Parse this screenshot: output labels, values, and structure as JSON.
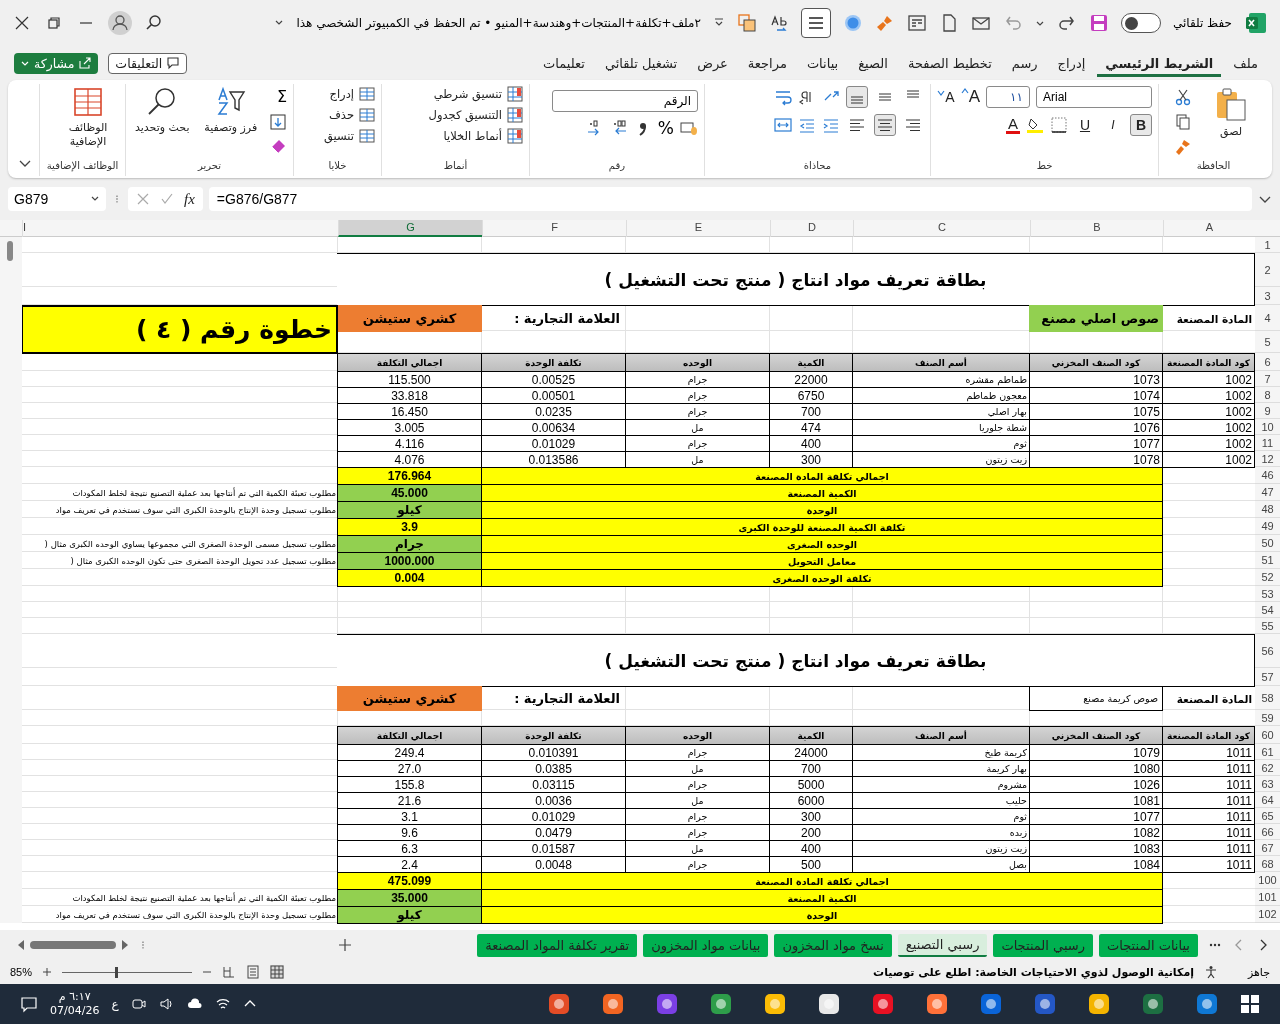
{
  "title_bar": {
    "autosave_label": "حفظ تلقائي",
    "autosave_on": false,
    "file_name": "٢ملف+تكلفة+المنتجات+وهندسة+المنيو • تم الحفظ في الكمبيوتر الشخصي هذا"
  },
  "ribbon_tabs": [
    {
      "label": "ملف",
      "selected": false
    },
    {
      "label": "الشريط الرئيسي",
      "selected": true
    },
    {
      "label": "إدراج",
      "selected": false
    },
    {
      "label": "رسم",
      "selected": false
    },
    {
      "label": "تخطيط الصفحة",
      "selected": false
    },
    {
      "label": "الصيغ",
      "selected": false
    },
    {
      "label": "بيانات",
      "selected": false
    },
    {
      "label": "مراجعة",
      "selected": false
    },
    {
      "label": "عرض",
      "selected": false
    },
    {
      "label": "تشغيل تلقائي",
      "selected": false
    },
    {
      "label": "تعليمات",
      "selected": false
    }
  ],
  "comments_label": "التعليقات",
  "share_label": "مشاركة",
  "ribbon": {
    "clipboard": {
      "label": "الحافظة",
      "paste": "لصق"
    },
    "font": {
      "label": "خط",
      "name": "Arial",
      "size": "١١",
      "grow": "A",
      "shrink": "A",
      "color_letter": "A",
      "styles": [
        {
          "kind": "bold",
          "label": "B",
          "on": true
        },
        {
          "kind": "italic",
          "label": "I",
          "on": false
        },
        {
          "kind": "underline",
          "label": "U",
          "on": false
        }
      ]
    },
    "alignment": {
      "label": "محاذاة",
      "vertical": [
        {
          "kind": "top",
          "selected": false
        },
        {
          "kind": "middle",
          "selected": false
        },
        {
          "kind": "bottom",
          "selected": true
        }
      ],
      "horizontal": [
        {
          "kind": "right",
          "selected": false
        },
        {
          "kind": "center",
          "selected": true
        },
        {
          "kind": "left",
          "selected": false
        }
      ]
    },
    "number": {
      "label": "رقم",
      "format": "الرقم",
      "percent": "%"
    },
    "styles": {
      "label": "أنماط",
      "items": [
        "تنسيق شرطي",
        "التنسيق كجدول",
        "أنماط الخلايا"
      ]
    },
    "cells": {
      "label": "خلايا",
      "items": [
        "إدراج",
        "حذف",
        "تنسيق"
      ]
    },
    "editing": {
      "label": "تحرير",
      "sum": "Σ",
      "sort": "فرز وتصفية",
      "find": "بحث وتحديد"
    },
    "addins": {
      "label": "الوظائف الإضافية",
      "button": "الوظائف الإضافية"
    }
  },
  "formula_bar": {
    "name_box": "G879",
    "fx": "fx",
    "formula": "=G876/G877"
  },
  "column_headers": [
    {
      "label": "A",
      "selected": false
    },
    {
      "label": "B",
      "selected": false
    },
    {
      "label": "C",
      "selected": false
    },
    {
      "label": "D",
      "selected": false
    },
    {
      "label": "E",
      "selected": false
    },
    {
      "label": "F",
      "selected": false
    },
    {
      "label": "G",
      "selected": true
    },
    {
      "label": "I",
      "selected": false
    }
  ],
  "sheet": {
    "rows": [
      {
        "nums": [
          "1"
        ],
        "kind": "blank"
      },
      {
        "nums": [
          "2",
          "3"
        ],
        "kind": "title",
        "text": "بطاقة تعريف مواد انتاج ( منتج تحت التشغيل )"
      },
      {
        "nums": [
          "4",
          "5"
        ],
        "kind": "material",
        "label": "المادة المصنعة",
        "value": "صوص اصلي مصنع",
        "highlighted": true,
        "brand_label": "العلامة التجارية :",
        "brand": "كشري ستيشن",
        "step": "خطوة رقم ( ٤ )"
      },
      {
        "nums": [
          "6"
        ],
        "kind": "header",
        "cells": [
          "كود المادة المصنعة",
          "كود الصنف المخزني",
          "أسم الصنف",
          "الكمية",
          "الوحده",
          "تكلفة الوحدة",
          "اجمالي التكلفة"
        ]
      },
      {
        "nums": [
          "7"
        ],
        "kind": "item",
        "cells": [
          "1002",
          "1073",
          "طماطم مقشره",
          "22000",
          "جرام",
          "0.00525",
          "115.500"
        ]
      },
      {
        "nums": [
          "8"
        ],
        "kind": "item",
        "cells": [
          "1002",
          "1074",
          "معجون طماطم",
          "6750",
          "جرام",
          "0.00501",
          "33.818"
        ]
      },
      {
        "nums": [
          "9"
        ],
        "kind": "item",
        "cells": [
          "1002",
          "1075",
          "بهار اصلي",
          "700",
          "جرام",
          "0.0235",
          "16.450"
        ]
      },
      {
        "nums": [
          "10"
        ],
        "kind": "item",
        "cells": [
          "1002",
          "1076",
          "شطة جلوريا",
          "474",
          "مل",
          "0.00634",
          "3.005"
        ]
      },
      {
        "nums": [
          "11"
        ],
        "kind": "item",
        "cells": [
          "1002",
          "1077",
          "ثوم",
          "400",
          "جرام",
          "0.01029",
          "4.116"
        ]
      },
      {
        "nums": [
          "12"
        ],
        "kind": "item",
        "cells": [
          "1002",
          "1078",
          "زيت زيتون",
          "300",
          "مل",
          "0.013586",
          "4.076"
        ]
      },
      {
        "nums": [
          "46"
        ],
        "kind": "summary",
        "label": "اجمالي تكلفة المادة المصنعة",
        "value": "176.964",
        "input": false
      },
      {
        "nums": [
          "47"
        ],
        "kind": "summary",
        "label": "الكمية المصنعة",
        "value": "45.000",
        "input": true,
        "note": "مطلوب تعبئة الكمية التي تم أنتاجها بعد عملية التصنيع نتيجة لخلط المكودات"
      },
      {
        "nums": [
          "48"
        ],
        "kind": "summary",
        "label": "الوحدة",
        "value": "كيلو",
        "input": true,
        "note": "مطلوب تسجيل وحدة الإنتاج بالوحدة الكبرى التي سوف تستخدم في تعريف مواد"
      },
      {
        "nums": [
          "49"
        ],
        "kind": "summary",
        "label": "تكلفة الكمية المصنعة للوحدة الكبرى",
        "value": "3.9",
        "input": false
      },
      {
        "nums": [
          "50"
        ],
        "kind": "summary",
        "label": "الوحده الصغرى",
        "value": "جرام",
        "input": true,
        "note": "مطلوب تسجيل مسمى الوحدة الصغرى التي مجموعها يساوي الوحده الكبرى مثال ("
      },
      {
        "nums": [
          "51"
        ],
        "kind": "summary",
        "label": "معامل التحويل",
        "value": "1000.000",
        "input": true,
        "note": "مطلوب تسجيل عدد تحويل الوحدة الصغرى حتى تكون الوحده الكبرى مثال ("
      },
      {
        "nums": [
          "52"
        ],
        "kind": "summary",
        "label": "تكلفة الوحده الصغرى",
        "value": "0.004",
        "input": false
      },
      {
        "nums": [
          "53",
          "54",
          "55"
        ],
        "kind": "blank"
      },
      {
        "nums": [
          "56",
          "57"
        ],
        "kind": "title",
        "text": "بطاقة تعريف مواد انتاج ( منتج تحت التشغيل )"
      },
      {
        "nums": [
          "58"
        ],
        "kind": "material",
        "label": "المادة المصنعة",
        "value": "صوص كريمة مصنع",
        "highlighted": false,
        "brand_label": "العلامة التجارية :",
        "brand": "كشري ستيشن"
      },
      {
        "nums": [
          "59"
        ],
        "kind": "blank"
      },
      {
        "nums": [
          "60"
        ],
        "kind": "header",
        "cells": [
          "كود المادة المصنعة",
          "كود الصنف المخزني",
          "أسم الصنف",
          "الكمية",
          "الوحده",
          "تكلفة الوحدة",
          "اجمالي التكلفة"
        ]
      },
      {
        "nums": [
          "61"
        ],
        "kind": "item",
        "cells": [
          "1011",
          "1079",
          "كريمة طبخ",
          "24000",
          "جرام",
          "0.010391",
          "249.4"
        ]
      },
      {
        "nums": [
          "62"
        ],
        "kind": "item",
        "cells": [
          "1011",
          "1080",
          "بهار كريمة",
          "700",
          "مل",
          "0.0385",
          "27.0"
        ]
      },
      {
        "nums": [
          "63"
        ],
        "kind": "item",
        "cells": [
          "1011",
          "1026",
          "مشروم",
          "5000",
          "جرام",
          "0.03115",
          "155.8"
        ]
      },
      {
        "nums": [
          "64"
        ],
        "kind": "item",
        "cells": [
          "1011",
          "1081",
          "حليب",
          "6000",
          "مل",
          "0.0036",
          "21.6"
        ]
      },
      {
        "nums": [
          "65"
        ],
        "kind": "item",
        "cells": [
          "1011",
          "1077",
          "ثوم",
          "300",
          "جرام",
          "0.01029",
          "3.1"
        ]
      },
      {
        "nums": [
          "66"
        ],
        "kind": "item",
        "cells": [
          "1011",
          "1082",
          "زبده",
          "200",
          "جرام",
          "0.0479",
          "9.6"
        ]
      },
      {
        "nums": [
          "67"
        ],
        "kind": "item",
        "cells": [
          "1011",
          "1083",
          "زيت زيتون",
          "400",
          "مل",
          "0.01587",
          "6.3"
        ]
      },
      {
        "nums": [
          "68"
        ],
        "kind": "item",
        "cells": [
          "1011",
          "1084",
          "بصل",
          "500",
          "جرام",
          "0.0048",
          "2.4"
        ]
      },
      {
        "nums": [
          "100"
        ],
        "kind": "summary",
        "label": "اجمالي تكلفة المادة المصنعة",
        "value": "475.099",
        "input": false
      },
      {
        "nums": [
          "101"
        ],
        "kind": "summary",
        "label": "الكمية المصنعة",
        "value": "35.000",
        "input": true,
        "note": "مطلوب تعبئة الكمية التي تم أنتاجها بعد عملية التصنيع نتيجة لخلط المكودات"
      },
      {
        "nums": [
          "102"
        ],
        "kind": "summary",
        "label": "الوحدة",
        "value": "كيلو",
        "input": true,
        "note": "مطلوب تسجيل وحدة الإنتاج بالوحدة الكبرى التي سوف تستخدم في تعريف مواد"
      }
    ]
  },
  "sheet_tabs": [
    {
      "label": "بيانات المنتجات",
      "selected": false
    },
    {
      "label": "رسبي المنتجات",
      "selected": false
    },
    {
      "label": "رسبي التصنيع",
      "selected": true
    },
    {
      "label": "نسخ مواد المخزون",
      "selected": false
    },
    {
      "label": "بيانات مواد المخزون",
      "selected": false
    },
    {
      "label": "تقرير تكلفة المواد المصنعة",
      "selected": false
    }
  ],
  "status_bar": {
    "ready": "جاهز",
    "accessibility": "إمكانية الوصول لذوي الاحتياجات الخاصة: اطلع على توصيات",
    "zoom": "85%",
    "zoom_level": {
      "level": 0.41
    }
  },
  "taskbar": {
    "time": "٦:١٧ م",
    "date": "07/04/26",
    "language": "ع"
  }
}
